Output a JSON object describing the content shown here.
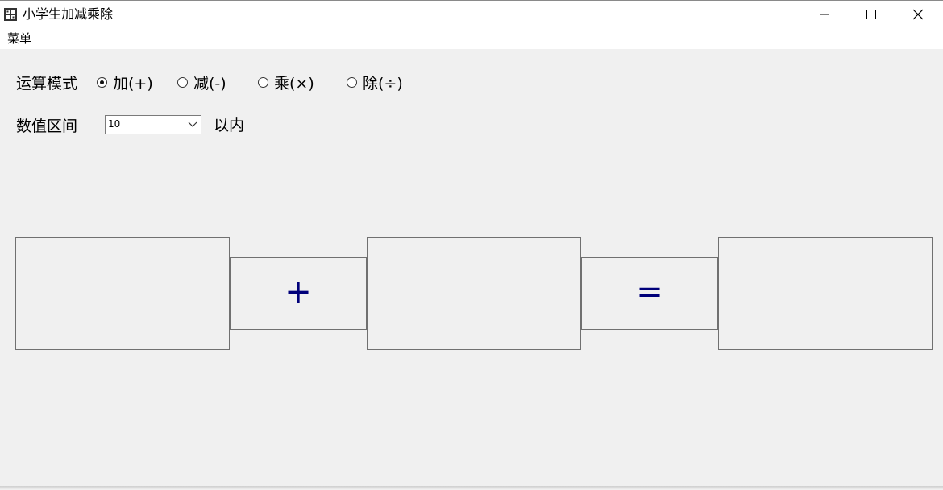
{
  "window": {
    "title": "小学生加减乘除",
    "app_icon": "calculator-grid-icon",
    "controls": [
      "minimize-icon",
      "maximize-icon",
      "close-icon"
    ]
  },
  "menu": {
    "items": [
      {
        "label": "菜单"
      }
    ]
  },
  "form": {
    "mode_label": "运算模式",
    "modes": [
      {
        "label": "加(+)",
        "selected": true
      },
      {
        "label": "减(-)",
        "selected": false
      },
      {
        "label": "乘(×)",
        "selected": false
      },
      {
        "label": "除(÷)",
        "selected": false
      }
    ],
    "range_label": "数值区间",
    "range_value": "10",
    "range_suffix": "以内"
  },
  "equation": {
    "operand1": "",
    "operator": "+",
    "operand2": "",
    "equals": "=",
    "result": "",
    "symbol_color": "#00007a"
  }
}
